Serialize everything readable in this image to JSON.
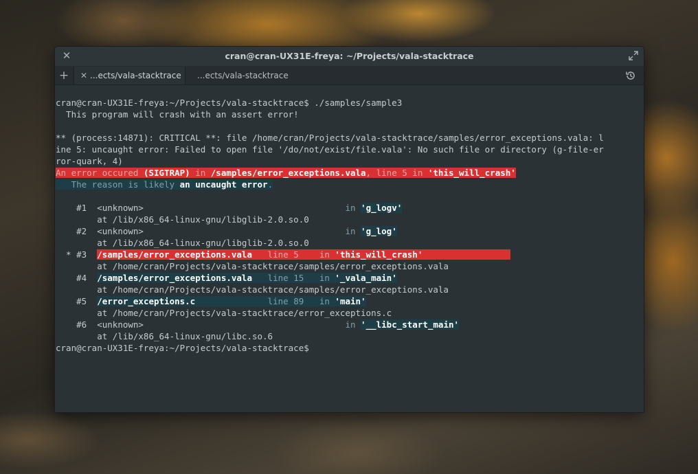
{
  "window": {
    "title": "cran@cran-UX31E-freya: ~/Projects/vala-stacktrace"
  },
  "tabs": [
    {
      "label": "...ects/vala-stacktrace"
    },
    {
      "label": "...ects/vala-stacktrace"
    }
  ],
  "icons": {
    "close": "close-icon",
    "maximize": "maximize-icon",
    "new_tab": "plus-icon",
    "history": "history-icon"
  },
  "colors": {
    "error_highlight": "#d93131",
    "frame_highlight": "#1d3e46",
    "terminal_bg": "#2b3235"
  },
  "terminal": {
    "l1_prompt": "cran@cran-UX31E-freya:~/Projects/vala-stacktrace$ ./samples/sample3",
    "l2": "  This program will crash with an assert error!",
    "l4": "** (process:14871): CRITICAL **: file /home/cran/Projects/vala-stacktrace/samples/error_exceptions.vala: l",
    "l5": "ine 5: uncaught error: Failed to open file '/do/not/exist/file.vala': No such file or directory (g-file-er",
    "l6": "ror-quark, 4)",
    "err_a": "An error occured ",
    "err_b": "(SIGTRAP)",
    "err_c": " in ",
    "err_d": "/samples/error_exceptions.vala",
    "err_e": ", line 5 in ",
    "err_f": "'this_will_crash'",
    "reason_a": "   The reason is likely ",
    "reason_b": "an uncaught error",
    "reason_c": ".",
    "frames": [
      {
        "marker": "    #1  ",
        "file": "<unknown>",
        "pad": "                             ",
        "line": "          ",
        "in": "in ",
        "func": "'g_logv'",
        "path": "        at /lib/x86_64-linux-gnu/libglib-2.0.so.0"
      },
      {
        "marker": "    #2  ",
        "file": "<unknown>",
        "pad": "                             ",
        "line": "          ",
        "in": "in ",
        "func": "'g_log'",
        "path": "        at /lib/x86_64-linux-gnu/libglib-2.0.so.0"
      },
      {
        "marker": "  * #3  ",
        "file": "/samples/error_exceptions.vala",
        "pad": "   ",
        "line": "line 5    ",
        "in": "in ",
        "func": "'this_will_crash'",
        "path": "        at /home/cran/Projects/vala-stacktrace/samples/error_exceptions.vala"
      },
      {
        "marker": "    #4  ",
        "file": "/samples/error_exceptions.vala",
        "pad": "   ",
        "line": "line 15   ",
        "in": "in ",
        "func": "'_vala_main'",
        "path": "        at /home/cran/Projects/vala-stacktrace/samples/error_exceptions.vala"
      },
      {
        "marker": "    #5  ",
        "file": "/error_exceptions.c",
        "pad": "              ",
        "line": "line 89   ",
        "in": "in ",
        "func": "'main'",
        "path": "        at /home/cran/Projects/vala-stacktrace/error_exceptions.c"
      },
      {
        "marker": "    #6  ",
        "file": "<unknown>",
        "pad": "                             ",
        "line": "          ",
        "in": "in ",
        "func": "'__libc_start_main'",
        "path": "        at /lib/x86_64-linux-gnu/libc.so.6"
      }
    ],
    "final_prompt": "cran@cran-UX31E-freya:~/Projects/vala-stacktrace$"
  }
}
